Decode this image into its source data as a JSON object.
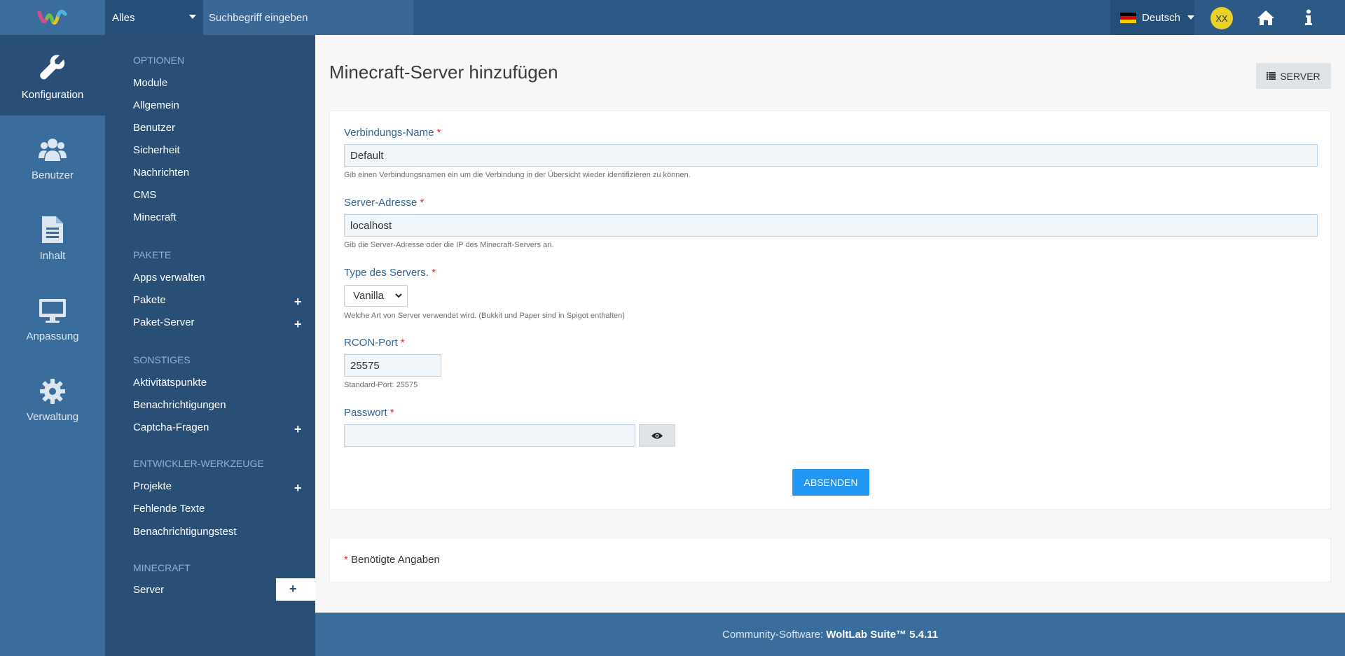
{
  "header": {
    "search_scope": "Alles",
    "search_placeholder": "Suchbegriff eingeben",
    "language": "Deutsch",
    "avatar_initials": "XX",
    "flag_colors": [
      "#000000",
      "#dd0000",
      "#ffce00"
    ]
  },
  "iconbar": [
    {
      "label": "Konfiguration",
      "icon": "wrench-icon",
      "active": true
    },
    {
      "label": "Benutzer",
      "icon": "users-icon",
      "active": false
    },
    {
      "label": "Inhalt",
      "icon": "document-icon",
      "active": false
    },
    {
      "label": "Anpassung",
      "icon": "monitor-icon",
      "active": false
    },
    {
      "label": "Verwaltung",
      "icon": "gear-icon",
      "active": false
    }
  ],
  "sidebar": {
    "sections": [
      {
        "heading": "Optionen",
        "items": [
          {
            "label": "Module"
          },
          {
            "label": "Allgemein"
          },
          {
            "label": "Benutzer"
          },
          {
            "label": "Sicherheit"
          },
          {
            "label": "Nachrichten"
          },
          {
            "label": "CMS"
          },
          {
            "label": "Minecraft"
          }
        ]
      },
      {
        "heading": "Pakete",
        "items": [
          {
            "label": "Apps verwalten"
          },
          {
            "label": "Pakete",
            "plus": true
          },
          {
            "label": "Paket-Server",
            "plus": true
          }
        ]
      },
      {
        "heading": "Sonstiges",
        "items": [
          {
            "label": "Aktivitätspunkte"
          },
          {
            "label": "Benachrichtigungen"
          },
          {
            "label": "Captcha-Fragen",
            "plus": true
          }
        ]
      },
      {
        "heading": "Entwickler-Werkzeuge",
        "items": [
          {
            "label": "Projekte",
            "plus": true
          },
          {
            "label": "Fehlende Texte"
          },
          {
            "label": "Benachrichtigungstest"
          }
        ]
      },
      {
        "heading": "Minecraft",
        "items": [
          {
            "label": "Server",
            "plus": true,
            "active": true
          }
        ]
      }
    ],
    "plus_symbol": "+"
  },
  "main": {
    "title": "Minecraft-Server hinzufügen",
    "server_button": "SERVER",
    "required_marker": "*",
    "fields": {
      "name": {
        "label": "Verbindungs-Name",
        "value": "Default",
        "help": "Gib einen Verbindungsnamen ein um die Verbindung in der Übersicht wieder identifizieren zu können."
      },
      "address": {
        "label": "Server-Adresse",
        "value": "localhost",
        "help": "Gib die Server-Adresse oder die IP des Minecraft-Servers an."
      },
      "type": {
        "label": "Type des Servers.",
        "value": "Vanilla",
        "help": "Welche Art von Server verwendet wird. (Bukkit und Paper sind in Spigot enthalten)"
      },
      "rcon": {
        "label": "RCON-Port",
        "value": "25575",
        "help": "Standard-Port: 25575"
      },
      "password": {
        "label": "Passwort",
        "value": ""
      }
    },
    "submit": "Absenden",
    "required_note": "Benötigte Angaben"
  },
  "footer": {
    "prefix": "Community-Software:",
    "product": "WoltLab Suite™ 5.4.11"
  },
  "colors": {
    "header": "#2d5987",
    "sidebar": "#2a4f76",
    "iconbar": "#3a6d9c",
    "accent_button": "#2196f3",
    "label": "#31649a"
  }
}
